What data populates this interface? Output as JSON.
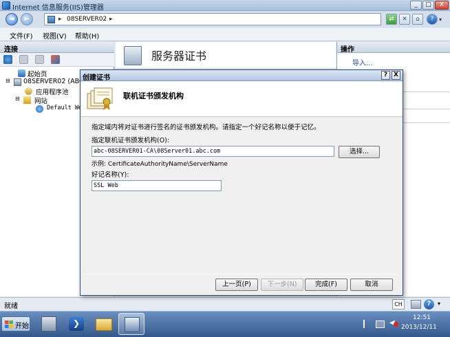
{
  "window": {
    "title": "Internet 信息服务(IIS)管理器",
    "min_label": "_",
    "restore_label": "□",
    "close_label": "X"
  },
  "address": {
    "back_label": "◄",
    "forward_label": "►",
    "sep1": "▸",
    "server": "08SERVER02",
    "sep2": "▸",
    "help_label": "?"
  },
  "menu": {
    "items": [
      "文件(F)",
      "视图(V)",
      "帮助(H)"
    ]
  },
  "connections": {
    "header": "连接",
    "tree": [
      {
        "label": "起始页"
      },
      {
        "label": "08SERVER02 (ABC\\"
      },
      {
        "label": "应用程序池"
      },
      {
        "label": "网站"
      },
      {
        "label": "Default We"
      }
    ]
  },
  "center": {
    "title": "服务器证书"
  },
  "actions": {
    "header": "操作",
    "import_link": "导入..."
  },
  "status": {
    "text": "就绪",
    "ime": "CH"
  },
  "dialog": {
    "title": "创建证书",
    "help_label": "?",
    "close_label": "X",
    "banner_title": "联机证书颁发机构",
    "instruction": "指定域内将对证书进行签名的证书颁发机构。请指定一个好记名称以便于记忆。",
    "ca_label": "指定联机证书颁发机构(O):",
    "ca_value": "abc-08SERVER01-CA\\08Server01.abc.com",
    "select_button": "选择...",
    "example": "示例: CertificateAuthorityName\\ServerName",
    "friendly_label": "好记名称(Y):",
    "friendly_value": "SSL Web",
    "buttons": {
      "prev": "上一页(P)",
      "next": "下一步(N)",
      "finish": "完成(F)",
      "cancel": "取消"
    }
  },
  "taskbar": {
    "start_label": "开始",
    "time": "12:51",
    "date": "2013/12/11"
  },
  "colors": {
    "accent": "#3b7bc8",
    "taskbar": "#35588c",
    "dialog_border": "#2a4b7a"
  }
}
